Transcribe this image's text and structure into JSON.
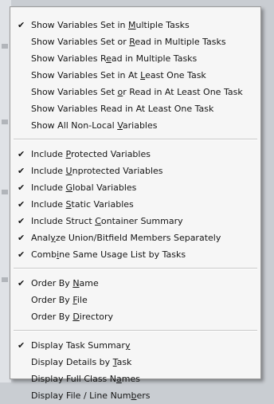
{
  "check_glyph": "✔",
  "menu": {
    "groups": [
      [
        {
          "pre": "Show Variables Set in ",
          "acc": "M",
          "post": "ultiple Tasks",
          "checked": true
        },
        {
          "pre": "Show Variables Set or ",
          "acc": "R",
          "post": "ead in Multiple Tasks",
          "checked": false
        },
        {
          "pre": "Show Variables R",
          "acc": "e",
          "post": "ad in Multiple Tasks",
          "checked": false
        },
        {
          "pre": "Show Variables Set in At ",
          "acc": "L",
          "post": "east One Task",
          "checked": false
        },
        {
          "pre": "Show Variables Set ",
          "acc": "o",
          "post": "r Read in At Least One Task",
          "checked": false
        },
        {
          "pre": "Show Variables Read in At Least One Task",
          "acc": "",
          "post": "",
          "checked": false
        },
        {
          "pre": "Show All Non-Local ",
          "acc": "V",
          "post": "ariables",
          "checked": false
        }
      ],
      [
        {
          "pre": "Include ",
          "acc": "P",
          "post": "rotected Variables",
          "checked": true
        },
        {
          "pre": "Include ",
          "acc": "U",
          "post": "nprotected Variables",
          "checked": true
        },
        {
          "pre": "Include ",
          "acc": "G",
          "post": "lobal Variables",
          "checked": true
        },
        {
          "pre": "Include ",
          "acc": "S",
          "post": "tatic Variables",
          "checked": true
        },
        {
          "pre": "Include Struct ",
          "acc": "C",
          "post": "ontainer Summary",
          "checked": true
        },
        {
          "pre": "Anal",
          "acc": "y",
          "post": "ze Union/Bitfield Members Separately",
          "checked": true
        },
        {
          "pre": "Comb",
          "acc": "i",
          "post": "ne Same Usage List by Tasks",
          "checked": true
        }
      ],
      [
        {
          "pre": "Order By ",
          "acc": "N",
          "post": "ame",
          "checked": true
        },
        {
          "pre": "Order By ",
          "acc": "F",
          "post": "ile",
          "checked": false
        },
        {
          "pre": "Order By ",
          "acc": "D",
          "post": "irectory",
          "checked": false
        }
      ],
      [
        {
          "pre": "Display Task Summar",
          "acc": "y",
          "post": "",
          "checked": true
        },
        {
          "pre": "Display Details by ",
          "acc": "T",
          "post": "ask",
          "checked": false
        },
        {
          "pre": "Display Full Class N",
          "acc": "a",
          "post": "mes",
          "checked": false
        },
        {
          "pre": "Display File / Line Num",
          "acc": "b",
          "post": "ers",
          "checked": false
        }
      ]
    ]
  }
}
